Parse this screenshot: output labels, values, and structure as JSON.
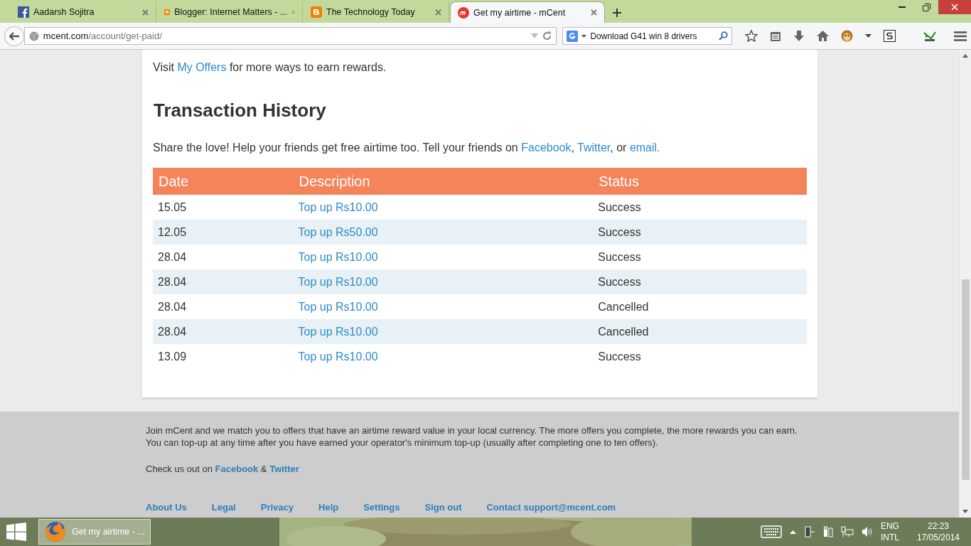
{
  "browser": {
    "tabs": [
      {
        "title": "Aadarsh Sojitra",
        "kind": "facebook",
        "selected": false
      },
      {
        "title": "Blogger: Internet Matters - ...",
        "kind": "blogger",
        "selected": false
      },
      {
        "title": "The Technology Today",
        "kind": "blogger",
        "selected": false
      },
      {
        "title": "Get my airtime - mCent",
        "kind": "mcent",
        "selected": true
      }
    ],
    "url": {
      "host": "mcent.com",
      "path": "/account/get-paid/"
    },
    "search": {
      "value": "Download G41 win 8 drivers"
    }
  },
  "page": {
    "intro": [
      {
        "text": "Visit "
      },
      {
        "text": "My Offers",
        "link": true
      },
      {
        "text": " for more ways to earn rewards."
      }
    ],
    "heading": "Transaction History",
    "share": [
      {
        "text": "Share the love! Help your friends get free airtime too. Tell your friends on "
      },
      {
        "text": "Facebook",
        "link": true
      },
      {
        "text": ", "
      },
      {
        "text": "Twitter",
        "link": true
      },
      {
        "text": ", or "
      },
      {
        "text": "email.",
        "link": true
      }
    ],
    "table": {
      "columns": [
        "Date",
        "Description",
        "Status"
      ],
      "rows": [
        {
          "date": "15.05",
          "description": "Top up Rs10.00",
          "status": "Success"
        },
        {
          "date": "12.05",
          "description": "Top up Rs50.00",
          "status": "Success"
        },
        {
          "date": "28.04",
          "description": "Top up Rs10.00",
          "status": "Success"
        },
        {
          "date": "28.04",
          "description": "Top up Rs10.00",
          "status": "Success"
        },
        {
          "date": "28.04",
          "description": "Top up Rs10.00",
          "status": "Cancelled"
        },
        {
          "date": "28.04",
          "description": "Top up Rs10.00",
          "status": "Cancelled"
        },
        {
          "date": "13.09",
          "description": "Top up Rs10.00",
          "status": "Success"
        }
      ]
    }
  },
  "footer": {
    "about": "Join mCent and we match you to offers that have an airtime reward value in your local currency. The more offers you complete, the more rewards you can earn. You can top-up at any time after you have earned your operator's minimum top-up (usually after completing one to ten offers).",
    "follow": [
      {
        "text": "Check us out on "
      },
      {
        "text": "Facebook",
        "link": true
      },
      {
        "text": " & "
      },
      {
        "text": "Twitter",
        "link": true
      }
    ],
    "links": [
      "About Us",
      "Legal",
      "Privacy",
      "Help",
      "Settings",
      "Sign out",
      "Contact support@mcent.com"
    ]
  },
  "taskbar": {
    "app": "Get my airtime - ...",
    "language": "ENG",
    "layout": "INTL",
    "time": "22:23",
    "date": "17/05/2014"
  }
}
